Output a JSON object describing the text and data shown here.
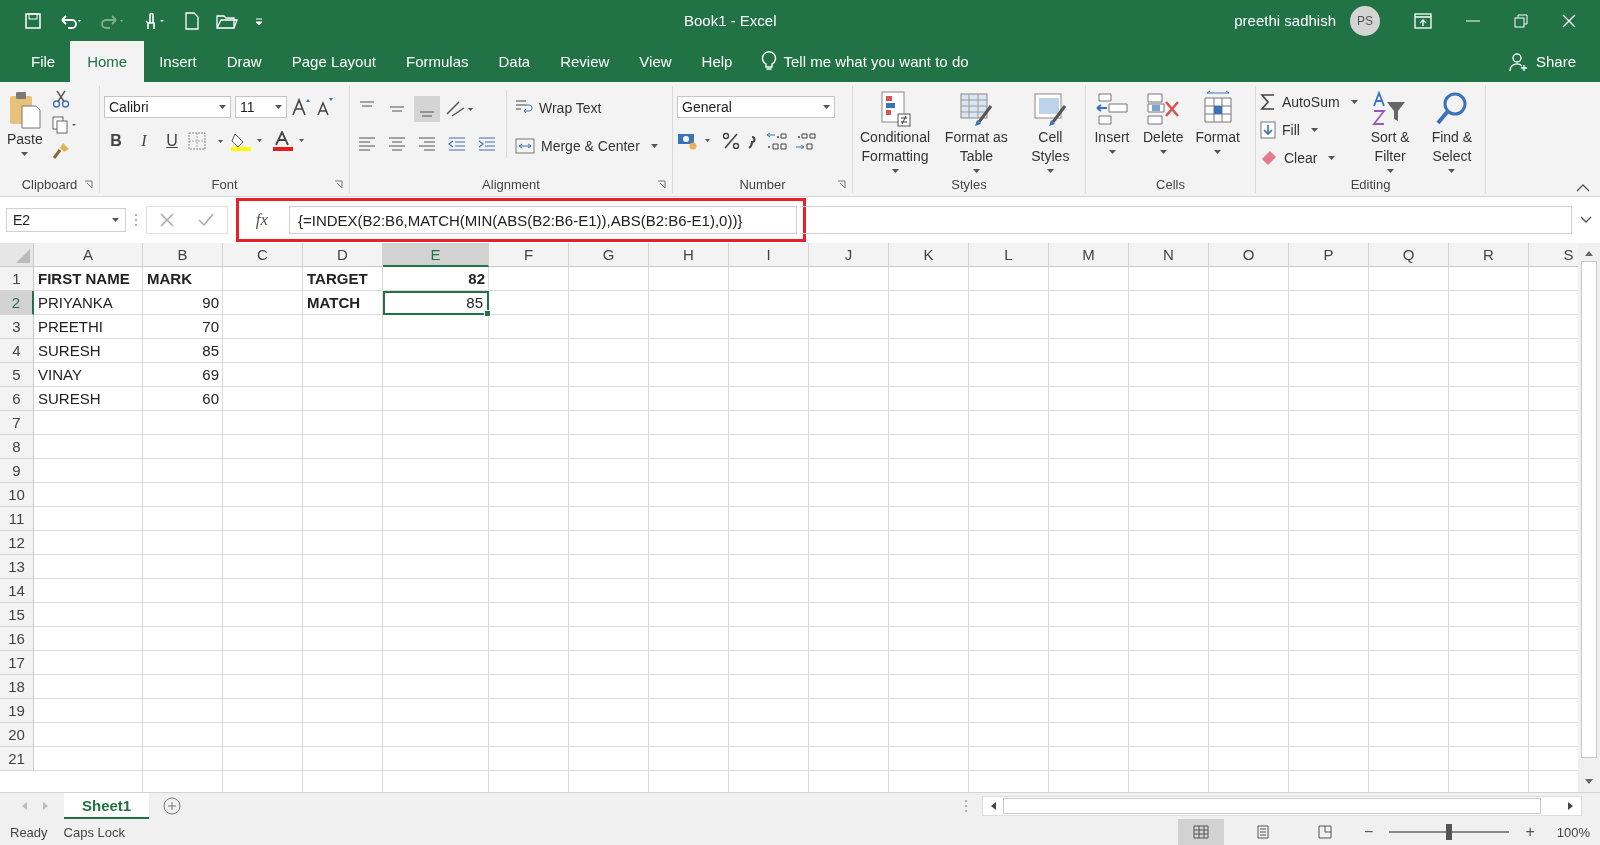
{
  "title_bar": {
    "title": "Book1  -  Excel",
    "user": "preethi sadhish",
    "avatar": "PS"
  },
  "menu_tabs": [
    {
      "label": "File",
      "selected": false
    },
    {
      "label": "Home",
      "selected": true
    },
    {
      "label": "Insert",
      "selected": false
    },
    {
      "label": "Draw",
      "selected": false
    },
    {
      "label": "Page Layout",
      "selected": false
    },
    {
      "label": "Formulas",
      "selected": false
    },
    {
      "label": "Data",
      "selected": false
    },
    {
      "label": "Review",
      "selected": false
    },
    {
      "label": "View",
      "selected": false
    },
    {
      "label": "Help",
      "selected": false
    }
  ],
  "tell_me": "Tell me what you want to do",
  "share": "Share",
  "ribbon": {
    "clipboard": {
      "paste": "Paste",
      "label": "Clipboard"
    },
    "font": {
      "font_name": "Calibri",
      "font_size": "11",
      "bold": "B",
      "italic": "I",
      "underline": "U",
      "label": "Font"
    },
    "alignment": {
      "wrap": "Wrap Text",
      "merge": "Merge & Center",
      "label": "Alignment"
    },
    "number": {
      "format": "General",
      "label": "Number"
    },
    "styles": {
      "buttons": [
        {
          "kind": "conditional",
          "label": "Conditional Formatting"
        },
        {
          "kind": "table",
          "label": "Format as Table"
        },
        {
          "kind": "cellstyles",
          "label": "Cell Styles"
        }
      ],
      "label": "Styles"
    },
    "cells": {
      "buttons": [
        {
          "kind": "insert",
          "label": "Insert"
        },
        {
          "kind": "delete",
          "label": "Delete"
        },
        {
          "kind": "format",
          "label": "Format"
        }
      ],
      "label": "Cells"
    },
    "editing": {
      "items": [
        {
          "kind": "autosum",
          "label": "AutoSum"
        },
        {
          "kind": "fill",
          "label": "Fill"
        },
        {
          "kind": "clear",
          "label": "Clear"
        }
      ],
      "buttons": [
        {
          "kind": "sort",
          "label": "Sort & Filter"
        },
        {
          "kind": "find",
          "label": "Find & Select"
        }
      ],
      "label": "Editing"
    }
  },
  "formula_bar": {
    "name_box": "E2",
    "fx": "fx",
    "formula": "{=INDEX(B2:B6,MATCH(MIN(ABS(B2:B6-E1)),ABS(B2:B6-E1),0))}",
    "highlighted": true
  },
  "sheet": {
    "columns": [
      {
        "label": "A",
        "selected": false
      },
      {
        "label": "B",
        "selected": false
      },
      {
        "label": "C",
        "selected": false
      },
      {
        "label": "D",
        "selected": false
      },
      {
        "label": "E",
        "selected": true
      },
      {
        "label": "F",
        "selected": false
      },
      {
        "label": "G",
        "selected": false
      },
      {
        "label": "H",
        "selected": false
      },
      {
        "label": "I",
        "selected": false
      },
      {
        "label": "J",
        "selected": false
      },
      {
        "label": "K",
        "selected": false
      },
      {
        "label": "L",
        "selected": false
      },
      {
        "label": "M",
        "selected": false
      },
      {
        "label": "N",
        "selected": false
      },
      {
        "label": "O",
        "selected": false
      },
      {
        "label": "P",
        "selected": false
      },
      {
        "label": "Q",
        "selected": false
      },
      {
        "label": "R",
        "selected": false
      },
      {
        "label": "S",
        "selected": false
      }
    ],
    "rows": [
      {
        "label": "1",
        "selected": false,
        "cells": [
          {
            "kind": "text",
            "text": "FIRST NAME",
            "bold": true,
            "selected": false
          },
          {
            "kind": "text",
            "text": "MARK",
            "bold": true,
            "selected": false
          },
          {
            "kind": "empty"
          },
          {
            "kind": "text",
            "text": "TARGET",
            "bold": true,
            "selected": false
          },
          {
            "kind": "number",
            "text": "82",
            "bold": true,
            "selected": false
          }
        ]
      },
      {
        "label": "2",
        "selected": true,
        "cells": [
          {
            "kind": "text",
            "text": "PRIYANKA",
            "bold": false,
            "selected": false
          },
          {
            "kind": "number",
            "text": "90",
            "bold": false,
            "selected": false
          },
          {
            "kind": "empty"
          },
          {
            "kind": "text",
            "text": "MATCH",
            "bold": true,
            "selected": false
          },
          {
            "kind": "number",
            "text": "85",
            "bold": false,
            "selected": true
          }
        ]
      },
      {
        "label": "3",
        "selected": false,
        "cells": [
          {
            "kind": "text",
            "text": "PREETHI",
            "bold": false,
            "selected": false
          },
          {
            "kind": "number",
            "text": "70",
            "bold": false,
            "selected": false
          }
        ]
      },
      {
        "label": "4",
        "selected": false,
        "cells": [
          {
            "kind": "text",
            "text": "SURESH",
            "bold": false,
            "selected": false
          },
          {
            "kind": "number",
            "text": "85",
            "bold": false,
            "selected": false
          }
        ]
      },
      {
        "label": "5",
        "selected": false,
        "cells": [
          {
            "kind": "text",
            "text": "VINAY",
            "bold": false,
            "selected": false
          },
          {
            "kind": "number",
            "text": "69",
            "bold": false,
            "selected": false
          }
        ]
      },
      {
        "label": "6",
        "selected": false,
        "cells": [
          {
            "kind": "text",
            "text": "SURESH",
            "bold": false,
            "selected": false
          },
          {
            "kind": "number",
            "text": "60",
            "bold": false,
            "selected": false
          }
        ]
      },
      {
        "label": "7",
        "selected": false,
        "cells": []
      },
      {
        "label": "8",
        "selected": false,
        "cells": []
      },
      {
        "label": "9",
        "selected": false,
        "cells": []
      },
      {
        "label": "10",
        "selected": false,
        "cells": []
      },
      {
        "label": "11",
        "selected": false,
        "cells": []
      },
      {
        "label": "12",
        "selected": false,
        "cells": []
      },
      {
        "label": "13",
        "selected": false,
        "cells": []
      },
      {
        "label": "14",
        "selected": false,
        "cells": []
      },
      {
        "label": "15",
        "selected": false,
        "cells": []
      },
      {
        "label": "16",
        "selected": false,
        "cells": []
      },
      {
        "label": "17",
        "selected": false,
        "cells": []
      },
      {
        "label": "18",
        "selected": false,
        "cells": []
      },
      {
        "label": "19",
        "selected": false,
        "cells": []
      },
      {
        "label": "20",
        "selected": false,
        "cells": []
      },
      {
        "label": "21",
        "selected": false,
        "cells": []
      }
    ]
  },
  "sheet_tabs": [
    {
      "label": "Sheet1",
      "selected": true
    }
  ],
  "status_bar": {
    "items": [
      "Ready",
      "Caps Lock"
    ],
    "views": [
      {
        "kind": "normal",
        "selected": true
      },
      {
        "kind": "layout",
        "selected": false
      },
      {
        "kind": "pagebreak",
        "selected": false
      }
    ],
    "zoom": {
      "level": 0.5,
      "minus": "−",
      "plus": "+",
      "reading": "100%"
    }
  }
}
